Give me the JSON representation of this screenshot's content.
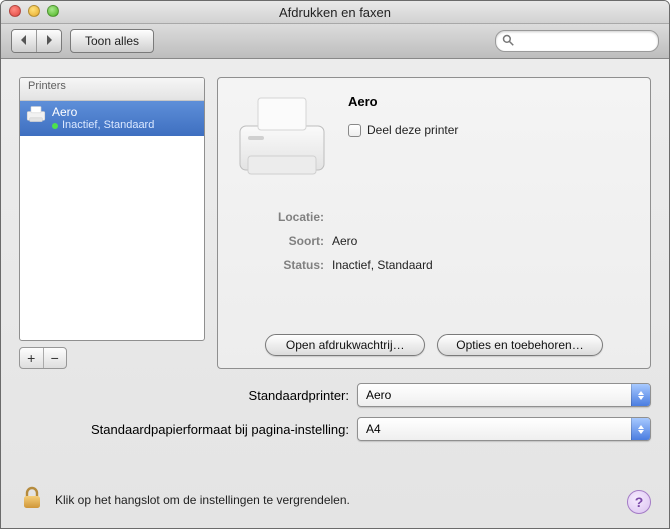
{
  "window": {
    "title": "Afdrukken en faxen"
  },
  "toolbar": {
    "show_all": "Toon alles",
    "search_placeholder": ""
  },
  "sidebar": {
    "header": "Printers",
    "item": {
      "name": "Aero",
      "status": "Inactief, Standaard"
    }
  },
  "add": "+",
  "remove": "−",
  "detail": {
    "name": "Aero",
    "share_label": "Deel deze printer",
    "location_label": "Locatie:",
    "location_value": "",
    "kind_label": "Soort:",
    "kind_value": "Aero",
    "status_label": "Status:",
    "status_value": "Inactief, Standaard",
    "open_queue": "Open afdrukwachtrij…",
    "options": "Opties en toebehoren…"
  },
  "form": {
    "default_printer_label": "Standaardprinter:",
    "default_printer_value": "Aero",
    "paper_label": "Standaardpapierformaat bij pagina-instelling:",
    "paper_value": "A4"
  },
  "lock_text": "Klik op het hangslot om de instellingen te vergrendelen.",
  "help": "?"
}
